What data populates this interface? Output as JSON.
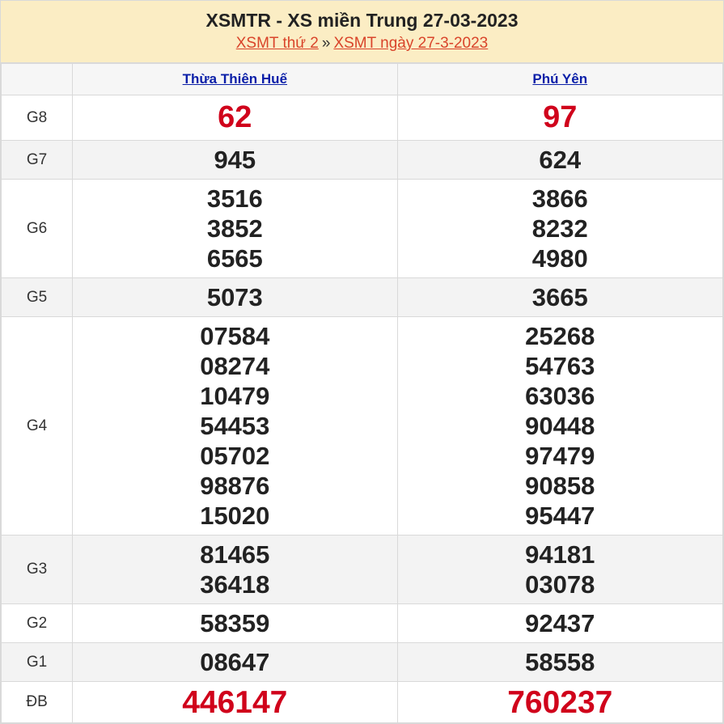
{
  "header": {
    "title": "XSMTR - XS miền Trung 27-03-2023",
    "crumb1": "XSMT thứ 2",
    "sep": "»",
    "crumb2": "XSMT ngày 27-3-2023"
  },
  "provinces": [
    "Thừa Thiên Huế",
    "Phú Yên"
  ],
  "prizes": [
    {
      "label": "G8",
      "values": [
        [
          "62"
        ],
        [
          "97"
        ]
      ]
    },
    {
      "label": "G7",
      "values": [
        [
          "945"
        ],
        [
          "624"
        ]
      ]
    },
    {
      "label": "G6",
      "values": [
        [
          "3516",
          "3852",
          "6565"
        ],
        [
          "3866",
          "8232",
          "4980"
        ]
      ]
    },
    {
      "label": "G5",
      "values": [
        [
          "5073"
        ],
        [
          "3665"
        ]
      ]
    },
    {
      "label": "G4",
      "values": [
        [
          "07584",
          "08274",
          "10479",
          "54453",
          "05702",
          "98876",
          "15020"
        ],
        [
          "25268",
          "54763",
          "63036",
          "90448",
          "97479",
          "90858",
          "95447"
        ]
      ]
    },
    {
      "label": "G3",
      "values": [
        [
          "81465",
          "36418"
        ],
        [
          "94181",
          "03078"
        ]
      ]
    },
    {
      "label": "G2",
      "values": [
        [
          "58359"
        ],
        [
          "92437"
        ]
      ]
    },
    {
      "label": "G1",
      "values": [
        [
          "08647"
        ],
        [
          "58558"
        ]
      ]
    },
    {
      "label": "ĐB",
      "values": [
        [
          "446147"
        ],
        [
          "760237"
        ]
      ]
    }
  ],
  "colors": {
    "header_bg": "#fbedc4",
    "accent_red": "#d0021b",
    "link_blue": "#0a1fa8"
  }
}
